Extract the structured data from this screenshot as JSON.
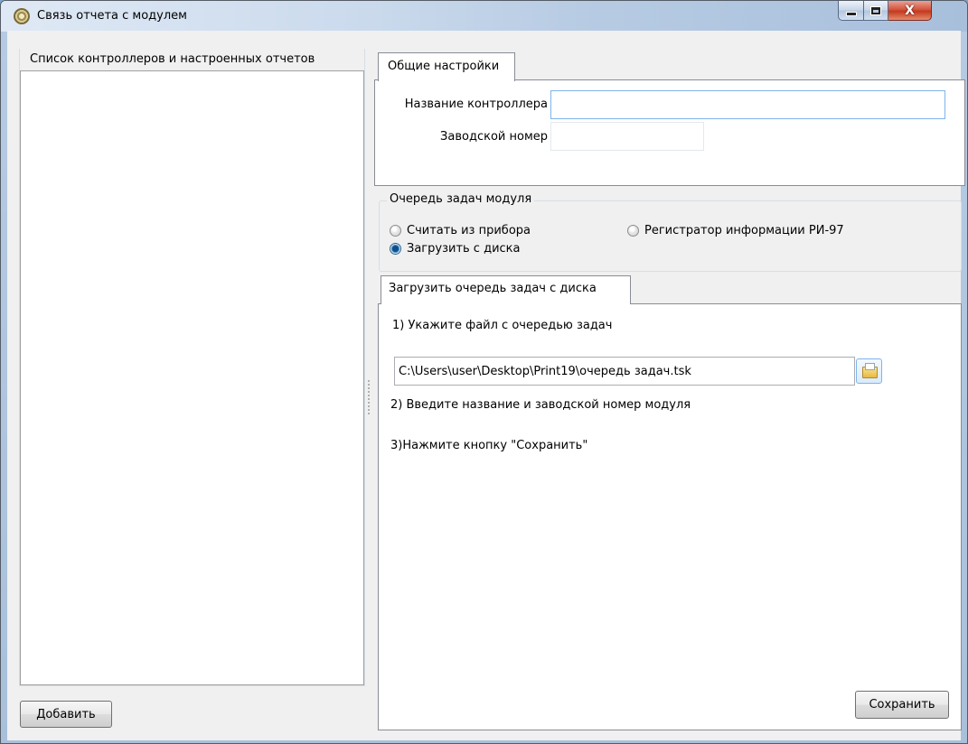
{
  "window": {
    "title": "Связь отчета с модулем"
  },
  "left_panel": {
    "title": "Список контроллеров и настроенных отчетов",
    "add_button": "Добавить"
  },
  "general_tab": {
    "label": "Общие настройки",
    "controller_name_label": "Название контроллера",
    "controller_name_value": "",
    "serial_label": "Заводской номер",
    "serial_value": ""
  },
  "task_queue": {
    "title": "Очередь задач модуля",
    "options": [
      {
        "label": "Считать из прибора",
        "selected": false
      },
      {
        "label": "Загрузить с диска",
        "selected": true
      },
      {
        "label": "Регистратор информации РИ-97",
        "selected": false
      }
    ]
  },
  "disk_tab": {
    "label": "Загрузить очередь задач с диска",
    "step1": "1) Укажите  файл с очередью задач",
    "file_path": "C:\\Users\\user\\Desktop\\Print19\\очередь задач.tsk",
    "step2": "2) Введите название и заводской номер модуля",
    "step3": "3)Нажмите кнопку \"Сохранить\"",
    "save_button": "Сохранить"
  }
}
